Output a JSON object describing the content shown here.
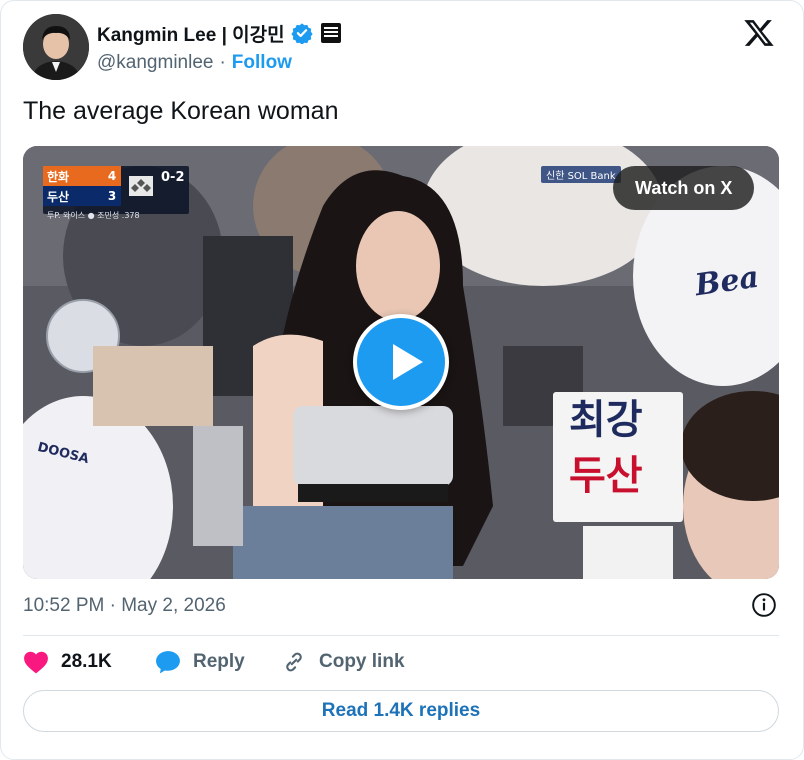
{
  "author": {
    "name": "Kangmin Lee | 이강민",
    "handle": "@kangminlee",
    "separator": "·",
    "follow_label": "Follow"
  },
  "tweet": {
    "text": "The average Korean woman"
  },
  "media": {
    "watch_label": "Watch on X",
    "bank_tag": "신한 SOL Bank",
    "scoreboard": {
      "team1": "한화",
      "score1": "4",
      "team2": "두산",
      "score2": "3",
      "inning": "0-2",
      "sub": "투P. 와이스  ● 조민성  .378"
    },
    "sign_line1": "최강",
    "sign_line2": "두산",
    "jersey_right": "Bea",
    "jersey_left": "DOOSA"
  },
  "meta": {
    "timestamp": "10:52 PM · May 2, 2026"
  },
  "actions": {
    "likes": "28.1K",
    "reply": "Reply",
    "copy_link": "Copy link",
    "read_replies": "Read 1.4K replies"
  },
  "colors": {
    "accent": "#1d9bf0",
    "like": "#f91880",
    "text": "#0f1419",
    "secondary": "#536471"
  }
}
